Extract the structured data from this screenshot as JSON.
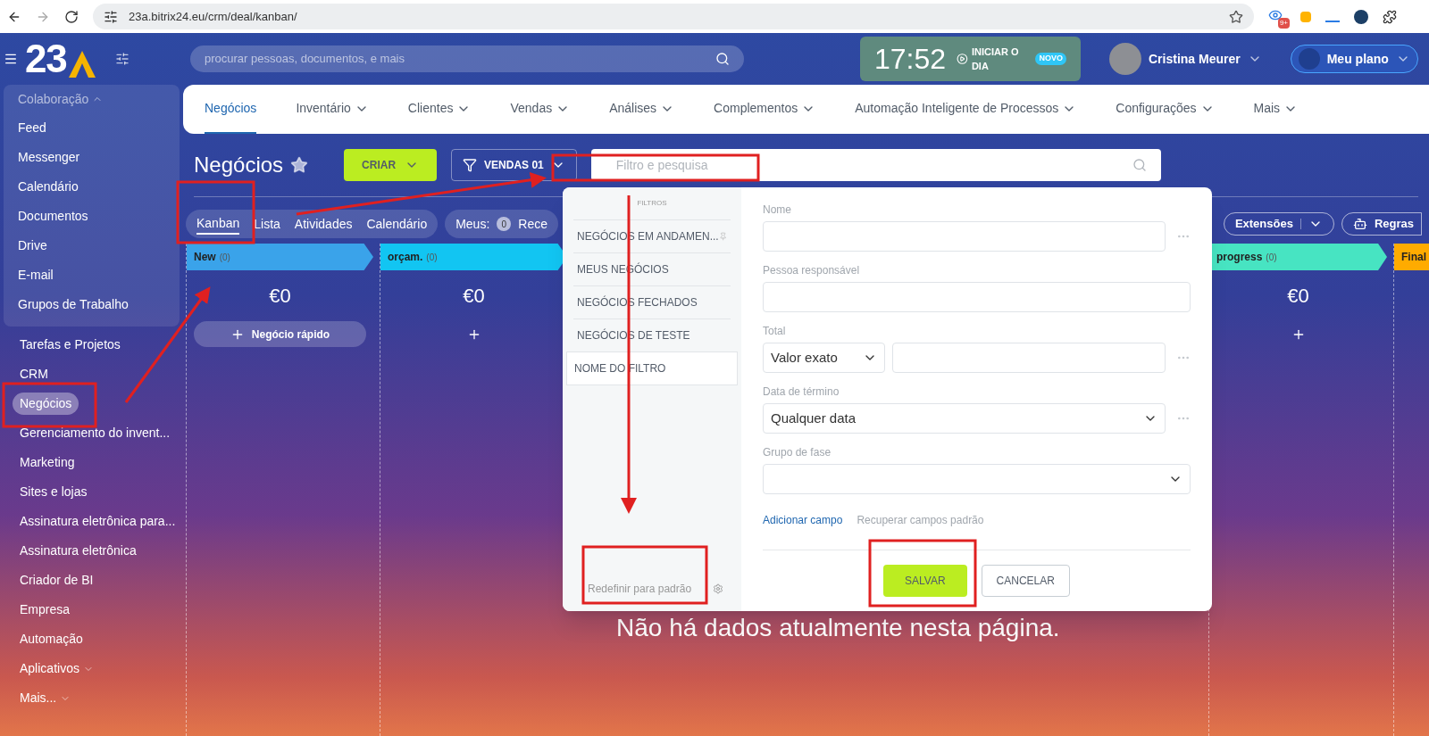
{
  "browser": {
    "url": "23a.bitrix24.eu/crm/deal/kanban/",
    "extension_badge": "9+"
  },
  "header": {
    "logo": "23",
    "search_placeholder": "procurar pessoas, documentos, e mais",
    "clock": "17:52",
    "start_day": "INICIAR O DIA",
    "start_day_badge": "NOVO",
    "user": "Cristina Meurer",
    "plan": "Meu plano"
  },
  "sidebar": {
    "group": {
      "label": "Colaboração",
      "expanded": true,
      "items": [
        {
          "label": "Feed",
          "selected": false
        },
        {
          "label": "Messenger",
          "selected": false
        },
        {
          "label": "Calendário",
          "selected": false
        },
        {
          "label": "Documentos",
          "selected": false
        },
        {
          "label": "Drive",
          "selected": false
        },
        {
          "label": "E-mail",
          "selected": false
        },
        {
          "label": "Grupos de Trabalho",
          "selected": false
        }
      ]
    },
    "items": [
      {
        "label": "Tarefas e Projetos",
        "selected": false,
        "has_menu": false
      },
      {
        "label": "CRM",
        "selected": false,
        "has_menu": false
      },
      {
        "label": "Negócios",
        "selected": true,
        "has_menu": false
      },
      {
        "label": "Gerenciamento do invent...",
        "selected": false,
        "has_menu": false
      },
      {
        "label": "Marketing",
        "selected": false,
        "has_menu": false
      },
      {
        "label": "Sites e lojas",
        "selected": false,
        "has_menu": false
      },
      {
        "label": "Assinatura eletrônica para...",
        "selected": false,
        "has_menu": false
      },
      {
        "label": "Assinatura eletrônica",
        "selected": false,
        "has_menu": false
      },
      {
        "label": "Criador de BI",
        "selected": false,
        "has_menu": false
      },
      {
        "label": "Empresa",
        "selected": false,
        "has_menu": false
      },
      {
        "label": "Automação",
        "selected": false,
        "has_menu": false
      },
      {
        "label": "Aplicativos",
        "selected": false,
        "has_menu": true
      },
      {
        "label": "Mais...",
        "selected": false,
        "has_menu": true
      }
    ]
  },
  "top_nav": [
    {
      "label": "Negócios",
      "selected": true,
      "has_menu": false
    },
    {
      "label": "Inventário",
      "selected": false,
      "has_menu": true
    },
    {
      "label": "Clientes",
      "selected": false,
      "has_menu": true
    },
    {
      "label": "Vendas",
      "selected": false,
      "has_menu": true
    },
    {
      "label": "Análises",
      "selected": false,
      "has_menu": true
    },
    {
      "label": "Complementos",
      "selected": false,
      "has_menu": true
    },
    {
      "label": "Automação Inteligente de Processos",
      "selected": false,
      "has_menu": true
    },
    {
      "label": "Configurações",
      "selected": false,
      "has_menu": true
    },
    {
      "label": "Mais",
      "selected": false,
      "has_menu": true
    }
  ],
  "toolbar": {
    "title": "Negócios",
    "create": "CRIAR",
    "category": "VENDAS 01",
    "filter_placeholder": "Filtro e pesquisa"
  },
  "views": [
    {
      "label": "Kanban",
      "selected": true
    },
    {
      "label": "Lista",
      "selected": false
    },
    {
      "label": "Atividades",
      "selected": false
    },
    {
      "label": "Calendário",
      "selected": false
    }
  ],
  "counters": {
    "label": "Meus:",
    "count": "0",
    "text": "Rece"
  },
  "right_buttons": {
    "extensions": "Extensões",
    "rules": "Regras"
  },
  "columns": [
    {
      "title": "New",
      "count": "(0)",
      "color": "#3aa3ea",
      "total": "€0",
      "kind": "quick",
      "add_label": "Negócio rápido"
    },
    {
      "title": "orçam.",
      "count": "(0)",
      "color": "#12c5f2",
      "total": "€0",
      "kind": "plus"
    },
    {
      "title": "progress",
      "count": "(0)",
      "color": "#47e4c2",
      "total": "€0",
      "kind": "plus"
    },
    {
      "title": "Final",
      "color": "#ffab00",
      "kind": "none"
    }
  ],
  "empty_message": "Não há dados atualmente nesta página.",
  "filter_popup": {
    "presets_title": "FILTROS",
    "presets": [
      {
        "label": "NEGÓCIOS EM ANDAMEN...",
        "pinned": true
      },
      {
        "label": "MEUS NEGÓCIOS",
        "pinned": false
      },
      {
        "label": "NEGÓCIOS FECHADOS",
        "pinned": false
      },
      {
        "label": "NEGÓCIOS DE TESTE",
        "pinned": false
      }
    ],
    "name_placeholder": "NOME DO FILTRO",
    "reset": "Redefinir para padrão",
    "fields": [
      {
        "label": "Nome",
        "kind": "text",
        "more": true
      },
      {
        "label": "Pessoa responsável",
        "kind": "text",
        "more": false
      },
      {
        "label": "Total",
        "kind": "select_text",
        "value": "Valor exato",
        "more": true
      },
      {
        "label": "Data de término",
        "kind": "select",
        "value": "Qualquer data",
        "more": true
      },
      {
        "label": "Grupo de fase",
        "kind": "select",
        "more": false
      }
    ],
    "add_field": "Adicionar campo",
    "restore_fields": "Recuperar campos padrão",
    "save": "SALVAR",
    "cancel": "CANCELAR"
  }
}
